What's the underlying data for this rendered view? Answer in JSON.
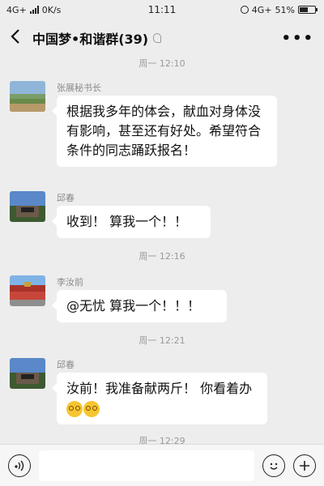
{
  "status_bar": {
    "network_left": "4G+",
    "speed": "0K/s",
    "clock": "11:11",
    "network_right": "4G+",
    "battery": "51%"
  },
  "header": {
    "back_icon": "chevron-left-icon",
    "title": "中国梦•和谐群(39)",
    "more_icon": "more-icon"
  },
  "timestamps": [
    "周一 12:10",
    "周一 12:16",
    "周一 12:21",
    "周一 12:29"
  ],
  "messages": [
    {
      "sender": "张展秘书长",
      "text": "根据我多年的体会，献血对身体没有影响，甚至还有好处。希望符合条件的同志踊跃报名！"
    },
    {
      "sender": "邱春",
      "text": "收到！ 算我一个！！"
    },
    {
      "sender": "李汝前",
      "text": "@无忧  算我一个！！！"
    },
    {
      "sender": "邱春",
      "text": "汝前！我准备献两斤！ 你看着办"
    }
  ],
  "bottom_bar": {
    "voice_icon": "voice-icon",
    "emoji_icon": "emoji-icon",
    "plus_icon": "plus-icon",
    "input_value": ""
  },
  "colors": {
    "background": "#ededed",
    "bubble": "#ffffff",
    "timestamp": "#9a9a9a"
  }
}
